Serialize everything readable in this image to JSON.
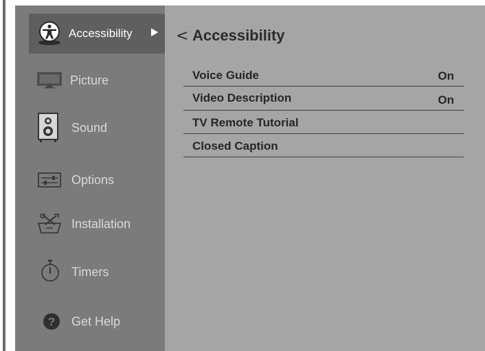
{
  "sidebar": {
    "items": [
      {
        "label": "Accessibility",
        "icon": "accessibility-icon",
        "selected": true
      },
      {
        "label": "Picture",
        "icon": "monitor-icon"
      },
      {
        "label": "Sound",
        "icon": "speaker-icon"
      },
      {
        "label": "Options",
        "icon": "sliders-icon"
      },
      {
        "label": "Installation",
        "icon": "tools-icon"
      },
      {
        "label": "Timers",
        "icon": "stopwatch-icon"
      },
      {
        "label": "Get Help",
        "icon": "help-icon"
      }
    ]
  },
  "main": {
    "back_glyph": "<",
    "title": "Accessibility",
    "rows": [
      {
        "label": "Voice Guide",
        "value": "On"
      },
      {
        "label": "Video Description",
        "value": "On"
      },
      {
        "label": "TV Remote Tutorial",
        "value": ""
      },
      {
        "label": "Closed Caption",
        "value": ""
      }
    ]
  },
  "colors": {
    "sidebar_bg": "#7b7b7b",
    "selected_bg": "#5f5f5f",
    "main_bg": "#a5a5a5",
    "text_dark": "#262626"
  }
}
